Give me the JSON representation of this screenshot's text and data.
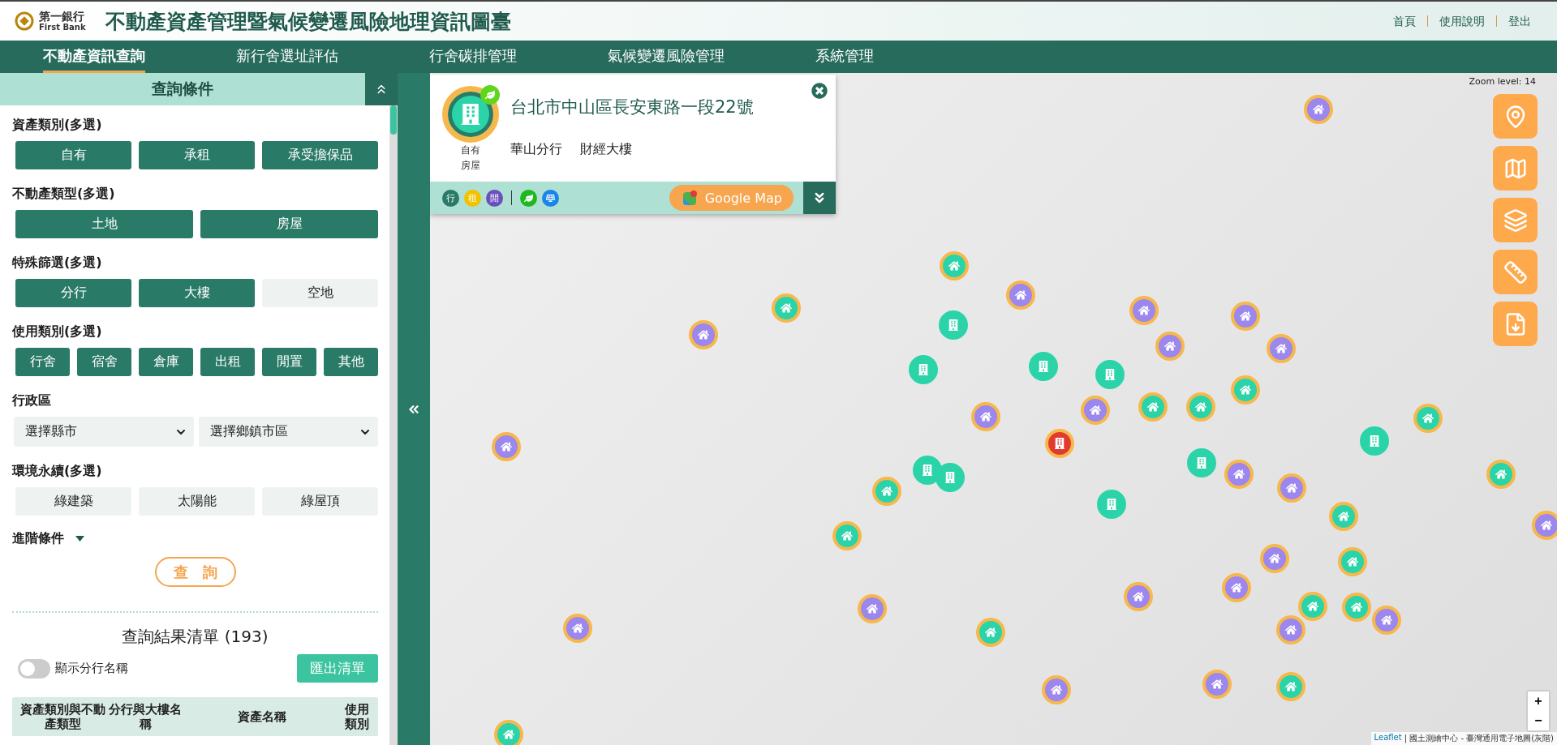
{
  "header": {
    "logo_text": "第一銀行",
    "logo_subtext": "First Bank",
    "title": "不動產資產管理暨氣候變遷風險地理資訊圖臺",
    "links": [
      "首頁",
      "使用說明",
      "登出"
    ]
  },
  "nav": [
    {
      "label": "不動產資訊查詢",
      "selected": true
    },
    {
      "label": "新行舍選址評估",
      "selected": false
    },
    {
      "label": "行舍碳排管理",
      "selected": false
    },
    {
      "label": "氣候變遷風險管理",
      "selected": false
    },
    {
      "label": "系統管理",
      "selected": false
    }
  ],
  "filter_panel": {
    "title": "查詢條件",
    "sections": [
      {
        "kind": "options",
        "label": "資產類別(多選)",
        "options": [
          {
            "label": "自有",
            "selected": true
          },
          {
            "label": "承租",
            "selected": true
          },
          {
            "label": "承受擔保品",
            "selected": true
          }
        ]
      },
      {
        "kind": "options",
        "label": "不動產類型(多選)",
        "options": [
          {
            "label": "土地",
            "selected": true
          },
          {
            "label": "房屋",
            "selected": true
          }
        ]
      },
      {
        "kind": "options",
        "label": "特殊篩選(多選)",
        "options": [
          {
            "label": "分行",
            "selected": true
          },
          {
            "label": "大樓",
            "selected": true
          },
          {
            "label": "空地",
            "selected": false
          }
        ]
      },
      {
        "kind": "options",
        "label": "使用類別(多選)",
        "options": [
          {
            "label": "行舍",
            "selected": true
          },
          {
            "label": "宿舍",
            "selected": true
          },
          {
            "label": "倉庫",
            "selected": true
          },
          {
            "label": "出租",
            "selected": true
          },
          {
            "label": "閒置",
            "selected": true
          },
          {
            "label": "其他",
            "selected": true
          }
        ]
      },
      {
        "kind": "selects",
        "label": "行政區",
        "selects": [
          {
            "value": "選擇縣市"
          },
          {
            "value": "選擇鄉鎮市區"
          }
        ]
      },
      {
        "kind": "options",
        "label": "環境永續(多選)",
        "options": [
          {
            "label": "綠建築",
            "selected": false
          },
          {
            "label": "太陽能",
            "selected": false
          },
          {
            "label": "綠屋頂",
            "selected": false
          }
        ]
      }
    ],
    "advanced": "進階條件",
    "search_button": "查　詢"
  },
  "results": {
    "title": "查詢結果清單 (193)",
    "toggle": {
      "label": "顯示分行名稱",
      "on": false
    },
    "export_button": "匯出清單",
    "columns": [
      "資產類別與不動產類型",
      "分行與大樓名稱",
      "資產名稱",
      "使用類別"
    ]
  },
  "popup": {
    "address": "台北市中山區長安東路一段22號",
    "category_lines": [
      "自有",
      "房屋"
    ],
    "branch": "華山分行",
    "building": "財經大樓",
    "tags": [
      {
        "label": "行",
        "color": "#2a7a68"
      },
      {
        "label": "租",
        "color": "#f2c200"
      },
      {
        "label": "閒",
        "color": "#6a50bd"
      }
    ],
    "google_map_button": "Google Map"
  },
  "map": {
    "zoom_label": "Zoom level: 14",
    "zoom_in": "+",
    "zoom_out": "−",
    "attribution_link": "Leaflet",
    "attribution": "| 國土測繪中心 - 臺灣通用電子地圖(灰階)",
    "markers": [
      {
        "kind": "house"
      },
      {
        "kind": "green"
      },
      {
        "kind": "house"
      },
      {
        "kind": "building"
      },
      {
        "kind": "building"
      },
      {
        "kind": "building"
      },
      {
        "kind": "house"
      },
      {
        "kind": "house"
      },
      {
        "kind": "house"
      },
      {
        "kind": "house"
      },
      {
        "kind": "building"
      },
      {
        "kind": "house"
      },
      {
        "kind": "green"
      },
      {
        "kind": "green"
      },
      {
        "kind": "green"
      },
      {
        "kind": "house"
      },
      {
        "kind": "selected"
      },
      {
        "kind": "building"
      },
      {
        "kind": "house"
      },
      {
        "kind": "house"
      },
      {
        "kind": "building"
      },
      {
        "kind": "green"
      },
      {
        "kind": "green"
      },
      {
        "kind": "house"
      },
      {
        "kind": "green"
      },
      {
        "kind": "house"
      },
      {
        "kind": "green"
      },
      {
        "kind": "house"
      },
      {
        "kind": "house"
      },
      {
        "kind": "green"
      },
      {
        "kind": "green"
      },
      {
        "kind": "house"
      },
      {
        "kind": "house"
      },
      {
        "kind": "house"
      },
      {
        "kind": "green"
      },
      {
        "kind": "house"
      },
      {
        "kind": "green"
      },
      {
        "kind": "house"
      },
      {
        "kind": "green"
      },
      {
        "kind": "green"
      },
      {
        "kind": "building"
      },
      {
        "kind": "building"
      },
      {
        "kind": "building"
      },
      {
        "kind": "green"
      },
      {
        "kind": "house"
      },
      {
        "kind": "house"
      },
      {
        "kind": "house"
      },
      {
        "kind": "green"
      }
    ]
  }
}
